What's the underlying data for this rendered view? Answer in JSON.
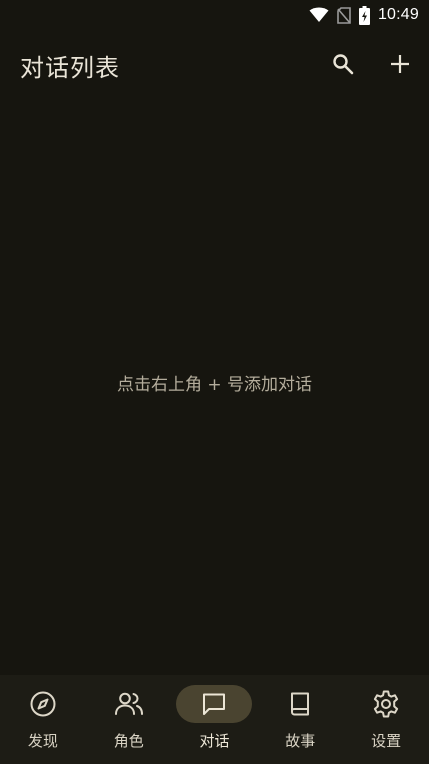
{
  "status_bar": {
    "time": "10:49",
    "icons": [
      "wifi-icon",
      "no-sim-icon",
      "battery-charging-icon"
    ]
  },
  "app_bar": {
    "title": "对话列表",
    "actions": [
      "search-icon",
      "add-icon"
    ]
  },
  "empty_state": {
    "message": "点击右上角 + 号添加对话"
  },
  "bottom_nav": {
    "active_index": 2,
    "items": [
      {
        "label": "发现",
        "icon": "compass-icon"
      },
      {
        "label": "角色",
        "icon": "people-icon"
      },
      {
        "label": "对话",
        "icon": "chat-icon"
      },
      {
        "label": "故事",
        "icon": "book-icon"
      },
      {
        "label": "设置",
        "icon": "gear-icon"
      }
    ]
  },
  "colors": {
    "background": "#16150f",
    "nav_background": "#1d1c15",
    "active_pill": "#4a4430",
    "text": "#e9e4d7",
    "hint_text": "#b4ad9c"
  }
}
